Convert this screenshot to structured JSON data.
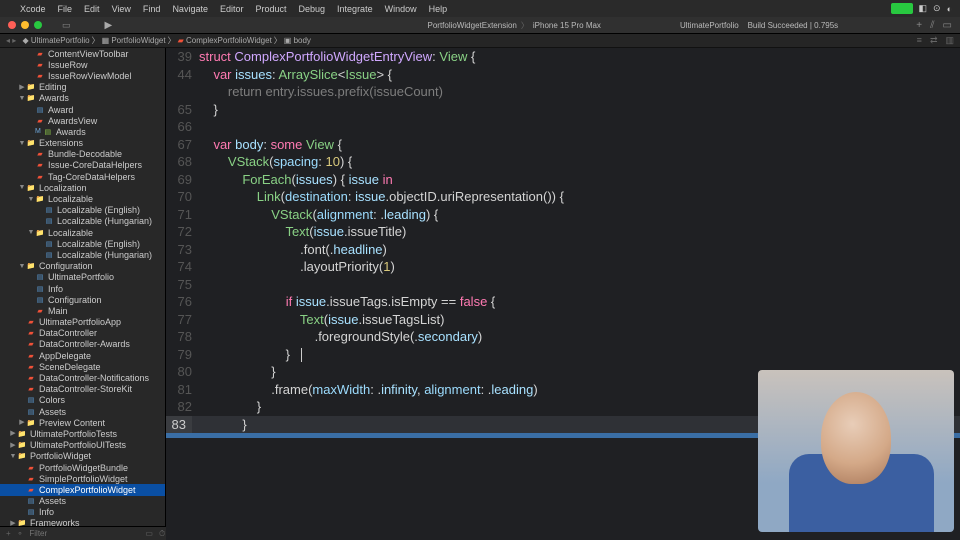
{
  "menu": {
    "apple": "",
    "items": [
      "Xcode",
      "File",
      "Edit",
      "View",
      "Find",
      "Navigate",
      "Editor",
      "Product",
      "Debug",
      "Integrate",
      "Window",
      "Help"
    ]
  },
  "toolbar": {
    "scheme": "PortfolioWidgetExtension",
    "device": "iPhone 15 Pro Max",
    "project": "UltimatePortfolio",
    "status": "Build Succeeded | 0.795s"
  },
  "breadcrumb": [
    "UltimatePortfolio",
    "PortfolioWidget",
    "ComplexPortfolioWidget",
    "body"
  ],
  "sidebar": [
    {
      "d": 3,
      "ic": "swift",
      "t": "ContentViewToolbar"
    },
    {
      "d": 3,
      "ic": "swift",
      "t": "IssueRow"
    },
    {
      "d": 3,
      "ic": "swift",
      "t": "IssueRowViewModel"
    },
    {
      "d": 2,
      "disc": "r",
      "ic": "folder",
      "t": "Editing"
    },
    {
      "d": 2,
      "disc": "d",
      "ic": "folder",
      "t": "Awards"
    },
    {
      "d": 3,
      "ic": "blue",
      "t": "Award"
    },
    {
      "d": 3,
      "ic": "swift",
      "t": "AwardsView"
    },
    {
      "d": 3,
      "m": true,
      "ic": "green",
      "t": "Awards"
    },
    {
      "d": 2,
      "disc": "d",
      "ic": "folder",
      "t": "Extensions"
    },
    {
      "d": 3,
      "ic": "swift",
      "t": "Bundle-Decodable"
    },
    {
      "d": 3,
      "ic": "swift",
      "t": "Issue-CoreDataHelpers"
    },
    {
      "d": 3,
      "ic": "swift",
      "t": "Tag-CoreDataHelpers"
    },
    {
      "d": 2,
      "disc": "d",
      "ic": "folder",
      "t": "Localization"
    },
    {
      "d": 3,
      "disc": "d",
      "ic": "folder",
      "t": "Localizable"
    },
    {
      "d": 4,
      "ic": "blue",
      "t": "Localizable (English)"
    },
    {
      "d": 4,
      "ic": "blue",
      "t": "Localizable (Hungarian)"
    },
    {
      "d": 3,
      "disc": "d",
      "ic": "folder",
      "t": "Localizable"
    },
    {
      "d": 4,
      "ic": "blue",
      "t": "Localizable (English)"
    },
    {
      "d": 4,
      "ic": "blue",
      "t": "Localizable (Hungarian)"
    },
    {
      "d": 2,
      "disc": "d",
      "ic": "folder",
      "t": "Configuration"
    },
    {
      "d": 3,
      "ic": "blue",
      "t": "UltimatePortfolio"
    },
    {
      "d": 3,
      "ic": "blue",
      "t": "Info"
    },
    {
      "d": 3,
      "ic": "blue",
      "t": "Configuration"
    },
    {
      "d": 3,
      "ic": "swift",
      "t": "Main"
    },
    {
      "d": 2,
      "ic": "swift",
      "t": "UltimatePortfolioApp"
    },
    {
      "d": 2,
      "ic": "swift",
      "t": "DataController"
    },
    {
      "d": 2,
      "ic": "swift",
      "t": "DataController-Awards"
    },
    {
      "d": 2,
      "ic": "swift",
      "t": "AppDelegate"
    },
    {
      "d": 2,
      "ic": "swift",
      "t": "SceneDelegate"
    },
    {
      "d": 2,
      "ic": "swift",
      "t": "DataController-Notifications"
    },
    {
      "d": 2,
      "ic": "swift",
      "t": "DataController-StoreKit"
    },
    {
      "d": 2,
      "ic": "blue",
      "t": "Colors"
    },
    {
      "d": 2,
      "ic": "blue",
      "t": "Assets"
    },
    {
      "d": 2,
      "disc": "r",
      "ic": "folder",
      "t": "Preview Content"
    },
    {
      "d": 1,
      "disc": "r",
      "ic": "folder",
      "t": "UltimatePortfolioTests"
    },
    {
      "d": 1,
      "disc": "r",
      "ic": "folder",
      "t": "UltimatePortfolioUITests"
    },
    {
      "d": 1,
      "disc": "d",
      "ic": "folder",
      "t": "PortfolioWidget"
    },
    {
      "d": 2,
      "ic": "swift",
      "t": "PortfolioWidgetBundle"
    },
    {
      "d": 2,
      "ic": "swift",
      "t": "SimplePortfolioWidget"
    },
    {
      "d": 2,
      "ic": "swift",
      "t": "ComplexPortfolioWidget",
      "sel": true
    },
    {
      "d": 2,
      "ic": "blue",
      "t": "Assets"
    },
    {
      "d": 2,
      "ic": "blue",
      "t": "Info"
    },
    {
      "d": 1,
      "disc": "r",
      "ic": "folder",
      "t": "Frameworks"
    }
  ],
  "filterPlaceholder": "Filter",
  "code": {
    "lines": [
      {
        "n": 39,
        "tokens": [
          [
            "kw",
            "struct"
          ],
          [
            "",
            " "
          ],
          [
            "type",
            "ComplexPortfolioWidgetEntryView"
          ],
          [
            "",
            ": "
          ],
          [
            "builtin",
            "View"
          ],
          [
            "",
            " {"
          ]
        ]
      },
      {
        "n": 44,
        "tokens": [
          [
            "",
            "    "
          ],
          [
            "kw",
            "var"
          ],
          [
            "",
            " "
          ],
          [
            "ident",
            "issues"
          ],
          [
            "",
            ": "
          ],
          [
            "builtin",
            "ArraySlice"
          ],
          [
            "",
            "<"
          ],
          [
            "builtin",
            "Issue"
          ],
          [
            "",
            "> {"
          ]
        ]
      },
      {
        "n": "",
        "tokens": [
          [
            "dim",
            "        return entry.issues.prefix(issueCount)"
          ]
        ]
      },
      {
        "n": 65,
        "tokens": [
          [
            "",
            "    }"
          ]
        ]
      },
      {
        "n": 66,
        "tokens": [
          [
            "",
            ""
          ]
        ]
      },
      {
        "n": 67,
        "tokens": [
          [
            "",
            "    "
          ],
          [
            "kw",
            "var"
          ],
          [
            "",
            " "
          ],
          [
            "ident",
            "body"
          ],
          [
            "",
            ": "
          ],
          [
            "kw",
            "some"
          ],
          [
            "",
            " "
          ],
          [
            "builtin",
            "View"
          ],
          [
            "",
            " {"
          ]
        ]
      },
      {
        "n": 68,
        "tokens": [
          [
            "",
            "        "
          ],
          [
            "builtin",
            "VStack"
          ],
          [
            "",
            "("
          ],
          [
            "prop",
            "spacing"
          ],
          [
            "",
            ": "
          ],
          [
            "num",
            "10"
          ],
          [
            "",
            ") {"
          ]
        ]
      },
      {
        "n": 69,
        "tokens": [
          [
            "",
            "            "
          ],
          [
            "builtin",
            "ForEach"
          ],
          [
            "",
            "("
          ],
          [
            "ident",
            "issues"
          ],
          [
            "",
            ") { "
          ],
          [
            "ident",
            "issue"
          ],
          [
            "",
            " "
          ],
          [
            "kw",
            "in"
          ]
        ]
      },
      {
        "n": 70,
        "tokens": [
          [
            "",
            "                "
          ],
          [
            "builtin",
            "Link"
          ],
          [
            "",
            "("
          ],
          [
            "prop",
            "destination"
          ],
          [
            "",
            ": "
          ],
          [
            "ident",
            "issue"
          ],
          [
            "",
            ".objectID.uriRepresentation()) {"
          ]
        ]
      },
      {
        "n": 71,
        "tokens": [
          [
            "",
            "                    "
          ],
          [
            "builtin",
            "VStack"
          ],
          [
            "",
            "("
          ],
          [
            "prop",
            "alignment"
          ],
          [
            "",
            ": ."
          ],
          [
            "ident",
            "leading"
          ],
          [
            "",
            ") {"
          ]
        ]
      },
      {
        "n": 72,
        "tokens": [
          [
            "",
            "                        "
          ],
          [
            "builtin",
            "Text"
          ],
          [
            "",
            "("
          ],
          [
            "ident",
            "issue"
          ],
          [
            "",
            ".issueTitle)"
          ]
        ]
      },
      {
        "n": 73,
        "tokens": [
          [
            "",
            "                            .font(."
          ],
          [
            "ident",
            "headline"
          ],
          [
            "",
            ")"
          ]
        ]
      },
      {
        "n": 74,
        "tokens": [
          [
            "",
            "                            .layoutPriority("
          ],
          [
            "num",
            "1"
          ],
          [
            "",
            ")"
          ]
        ]
      },
      {
        "n": 75,
        "tokens": [
          [
            "",
            ""
          ]
        ]
      },
      {
        "n": 76,
        "tokens": [
          [
            "",
            "                        "
          ],
          [
            "kw",
            "if"
          ],
          [
            "",
            " "
          ],
          [
            "ident",
            "issue"
          ],
          [
            "",
            ".issueTags.isEmpty == "
          ],
          [
            "kw",
            "false"
          ],
          [
            "",
            " {"
          ]
        ]
      },
      {
        "n": 77,
        "tokens": [
          [
            "",
            "                            "
          ],
          [
            "builtin",
            "Text"
          ],
          [
            "",
            "("
          ],
          [
            "ident",
            "issue"
          ],
          [
            "",
            ".issueTagsList)"
          ]
        ]
      },
      {
        "n": 78,
        "tokens": [
          [
            "",
            "                                .foregroundStyle(."
          ],
          [
            "ident",
            "secondary"
          ],
          [
            "",
            ")"
          ]
        ]
      },
      {
        "n": 79,
        "tokens": [
          [
            "",
            "                        }   "
          ],
          [
            "cursor",
            ""
          ]
        ]
      },
      {
        "n": 80,
        "tokens": [
          [
            "",
            "                    }"
          ]
        ]
      },
      {
        "n": 81,
        "tokens": [
          [
            "",
            "                    .frame("
          ],
          [
            "prop",
            "maxWidth"
          ],
          [
            "",
            ": ."
          ],
          [
            "ident",
            "infinity"
          ],
          [
            "",
            ", "
          ],
          [
            "prop",
            "alignment"
          ],
          [
            "",
            ": ."
          ],
          [
            "ident",
            "leading"
          ],
          [
            "",
            ")"
          ]
        ]
      },
      {
        "n": 82,
        "tokens": [
          [
            "",
            "                }"
          ]
        ]
      },
      {
        "n": 83,
        "hl": true,
        "tokens": [
          [
            "",
            "            }"
          ]
        ]
      }
    ]
  }
}
